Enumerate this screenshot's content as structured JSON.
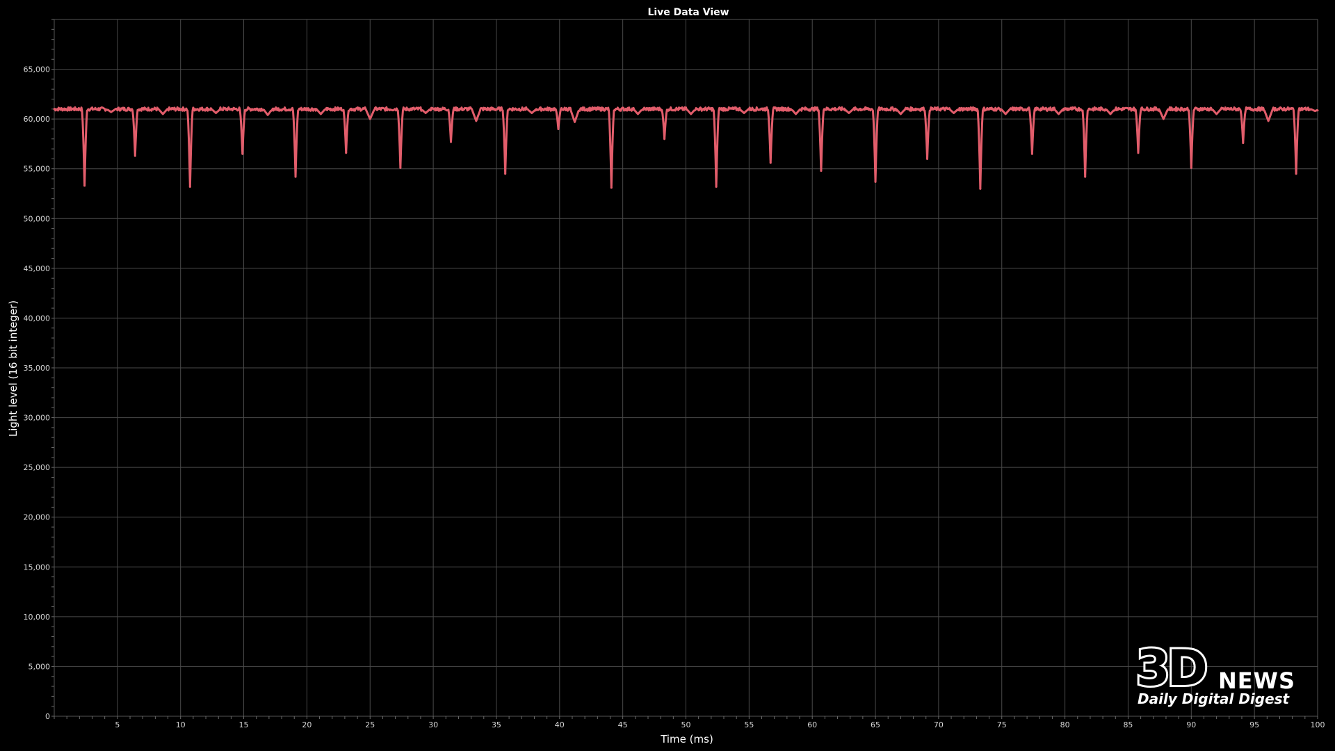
{
  "colors": {
    "background": "#000000",
    "grid": "#4a4a4a",
    "series": "#e25d6b",
    "text": "#ffffff"
  },
  "watermark": {
    "logo_main": "3D",
    "logo_sub": "NEWS",
    "tagline": "Daily Digital Digest"
  },
  "chart_data": {
    "type": "line",
    "title": "Live Data View",
    "xlabel": "Time (ms)",
    "ylabel": "Light level (16 bit integer)",
    "xlim": [
      0,
      100
    ],
    "ylim": [
      0,
      70000
    ],
    "grid": true,
    "x_ticks": [
      {
        "value": 5,
        "label": "5"
      },
      {
        "value": 10,
        "label": "10"
      },
      {
        "value": 15,
        "label": "15"
      },
      {
        "value": 20,
        "label": "20"
      },
      {
        "value": 25,
        "label": "25"
      },
      {
        "value": 30,
        "label": "30"
      },
      {
        "value": 35,
        "label": "35"
      },
      {
        "value": 40,
        "label": "40"
      },
      {
        "value": 45,
        "label": "45"
      },
      {
        "value": 50,
        "label": "50"
      },
      {
        "value": 55,
        "label": "55"
      },
      {
        "value": 60,
        "label": "60"
      },
      {
        "value": 65,
        "label": "65"
      },
      {
        "value": 70,
        "label": "70"
      },
      {
        "value": 75,
        "label": "75"
      },
      {
        "value": 80,
        "label": "80"
      },
      {
        "value": 85,
        "label": "85"
      },
      {
        "value": 90,
        "label": "90"
      },
      {
        "value": 95,
        "label": "95"
      },
      {
        "value": 100,
        "label": "100"
      }
    ],
    "y_ticks": [
      {
        "value": 0,
        "label": "0"
      },
      {
        "value": 5000,
        "label": "5,000"
      },
      {
        "value": 10000,
        "label": "10,000"
      },
      {
        "value": 15000,
        "label": "15,000"
      },
      {
        "value": 20000,
        "label": "20,000"
      },
      {
        "value": 25000,
        "label": "25,000"
      },
      {
        "value": 30000,
        "label": "30,000"
      },
      {
        "value": 35000,
        "label": "35,000"
      },
      {
        "value": 40000,
        "label": "40,000"
      },
      {
        "value": 45000,
        "label": "45,000"
      },
      {
        "value": 50000,
        "label": "50,000"
      },
      {
        "value": 55000,
        "label": "55,000"
      },
      {
        "value": 60000,
        "label": "60,000"
      },
      {
        "value": 65000,
        "label": "65,000"
      }
    ],
    "series": [
      {
        "baseline": 61000,
        "dips": [
          {
            "x": 2.4,
            "y": 53300
          },
          {
            "x": 6.4,
            "y": 56300
          },
          {
            "x": 10.75,
            "y": 53200
          },
          {
            "x": 14.9,
            "y": 56500
          },
          {
            "x": 19.1,
            "y": 54200
          },
          {
            "x": 23.1,
            "y": 56600
          },
          {
            "x": 27.4,
            "y": 55100
          },
          {
            "x": 31.4,
            "y": 57700
          },
          {
            "x": 35.7,
            "y": 54500
          },
          {
            "x": 39.9,
            "y": 59000
          },
          {
            "x": 44.1,
            "y": 53100
          },
          {
            "x": 48.3,
            "y": 58000
          },
          {
            "x": 52.4,
            "y": 53200
          },
          {
            "x": 56.7,
            "y": 55600
          },
          {
            "x": 60.7,
            "y": 54800
          },
          {
            "x": 65.0,
            "y": 53700
          },
          {
            "x": 69.1,
            "y": 56000
          },
          {
            "x": 73.3,
            "y": 53000
          },
          {
            "x": 77.4,
            "y": 56500
          },
          {
            "x": 81.6,
            "y": 54200
          },
          {
            "x": 85.8,
            "y": 56600
          },
          {
            "x": 90.0,
            "y": 55100
          },
          {
            "x": 94.1,
            "y": 57600
          },
          {
            "x": 98.3,
            "y": 54500
          }
        ],
        "small_dips": [
          {
            "x": 4.5,
            "y": 60700
          },
          {
            "x": 8.6,
            "y": 60500
          },
          {
            "x": 12.8,
            "y": 60600
          },
          {
            "x": 16.9,
            "y": 60400
          },
          {
            "x": 21.1,
            "y": 60500
          },
          {
            "x": 25.0,
            "y": 60000
          },
          {
            "x": 29.4,
            "y": 60600
          },
          {
            "x": 33.4,
            "y": 59800
          },
          {
            "x": 37.8,
            "y": 60600
          },
          {
            "x": 41.2,
            "y": 59700
          },
          {
            "x": 46.2,
            "y": 60500
          },
          {
            "x": 50.4,
            "y": 60500
          },
          {
            "x": 54.6,
            "y": 60600
          },
          {
            "x": 58.7,
            "y": 60500
          },
          {
            "x": 62.9,
            "y": 60600
          },
          {
            "x": 67.0,
            "y": 60500
          },
          {
            "x": 71.2,
            "y": 60600
          },
          {
            "x": 75.3,
            "y": 60500
          },
          {
            "x": 79.5,
            "y": 60500
          },
          {
            "x": 83.6,
            "y": 60500
          },
          {
            "x": 87.8,
            "y": 60000
          },
          {
            "x": 92.0,
            "y": 60500
          },
          {
            "x": 96.1,
            "y": 59800
          },
          {
            "x": 99.8,
            "y": 60800
          }
        ]
      }
    ]
  }
}
